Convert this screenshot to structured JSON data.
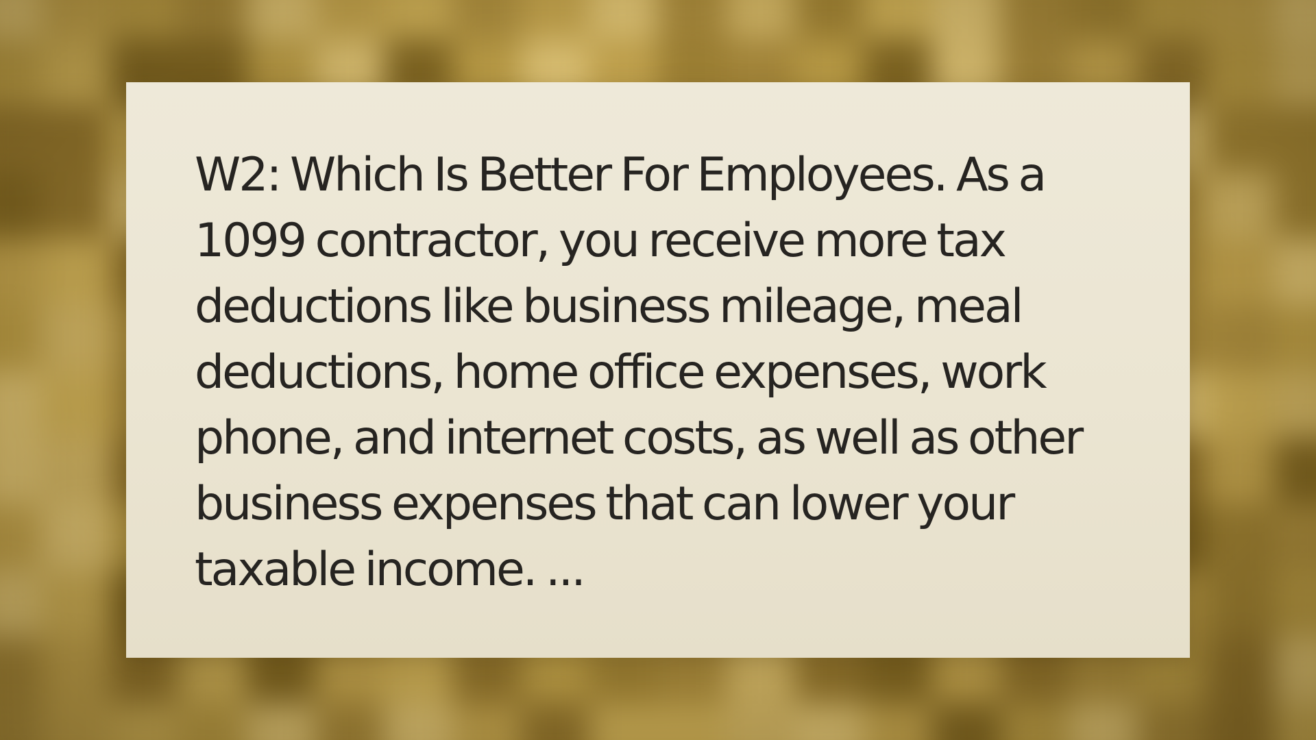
{
  "card": {
    "text": "W2: Which Is Better For Employees. As a 1099 contractor, you receive more tax deductions like business mileage, meal deductions, home office expenses, work phone, and internet costs, as well as other business expenses that can lower your taxable income. ..."
  },
  "colors": {
    "background_base": "#b3953f",
    "background_light": "#d2b66a",
    "background_dark": "#7f6522",
    "card_background": "#ebe5d2",
    "text": "#262421"
  }
}
